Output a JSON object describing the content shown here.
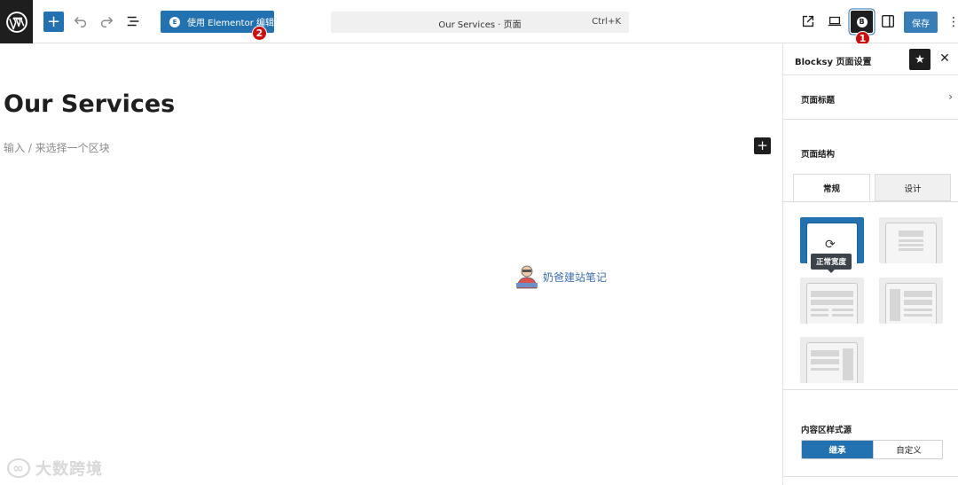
{
  "toolbar": {
    "elementor_label": "使用 Elementor 编辑",
    "command_title": "Our Services · 页面",
    "command_shortcut": "Ctrl+K",
    "save_label": "保存",
    "badge_1": "1",
    "badge_2": "2",
    "accent_color": "#2271b1"
  },
  "editor": {
    "page_title": "Our Services",
    "block_placeholder": "输入 / 来选择一个区块"
  },
  "watermark": {
    "center_text": "奶爸建站笔记",
    "bottom_text": "大数跨境"
  },
  "sidebar": {
    "title": "Blocksy 页面设置",
    "section_page_title": "页面标题",
    "section_structure": "页面结构",
    "tabs": [
      {
        "label": "常规",
        "active": true
      },
      {
        "label": "设计",
        "active": false
      }
    ],
    "layout_tooltip": "正常宽度",
    "content_source_label": "内容区样式源",
    "content_source_options": [
      {
        "label": "继承",
        "selected": true
      },
      {
        "label": "自定义",
        "selected": false
      }
    ]
  },
  "icons": [
    "wordpress-logo-icon",
    "plus-icon",
    "undo-icon",
    "redo-icon",
    "document-overview-icon",
    "elementor-icon",
    "external-link-icon",
    "desktop-preview-icon",
    "blocksy-icon",
    "sidebar-toggle-icon",
    "more-vertical-icon",
    "star-icon",
    "close-icon",
    "chevron-right-icon",
    "refresh-icon"
  ]
}
